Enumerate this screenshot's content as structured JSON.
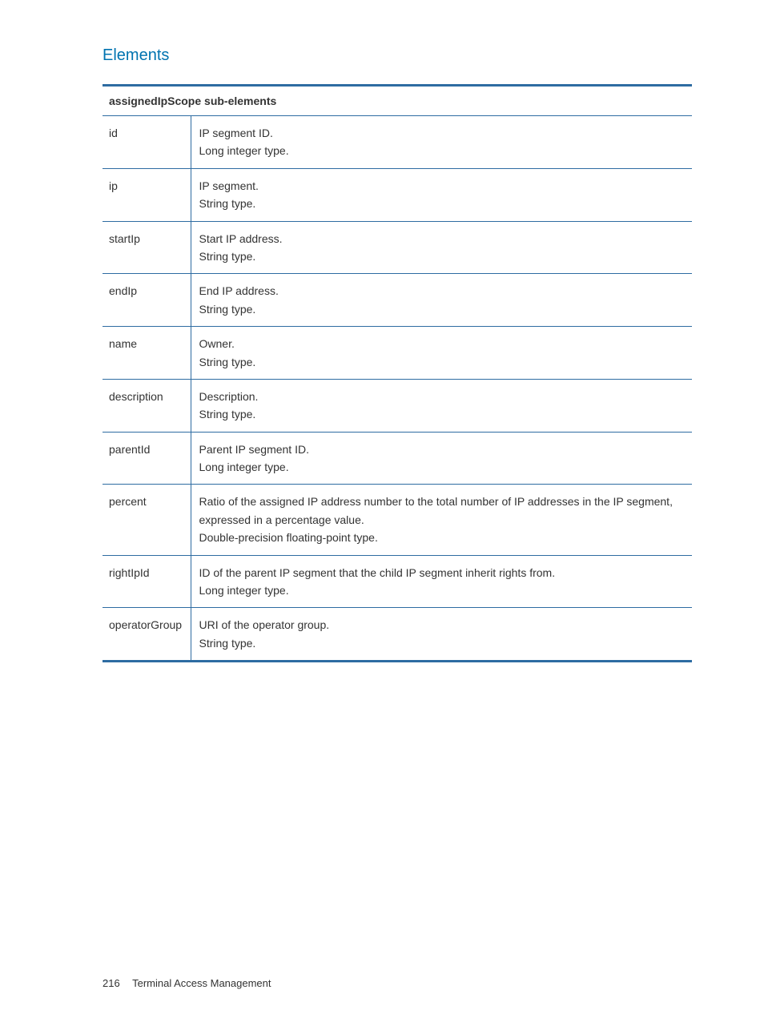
{
  "heading": "Elements",
  "table": {
    "header": "assignedIpScope sub-elements",
    "rows": [
      {
        "name": "id",
        "lines": [
          "IP segment ID.",
          "Long integer type."
        ]
      },
      {
        "name": "ip",
        "lines": [
          "IP segment.",
          "String type."
        ]
      },
      {
        "name": "startIp",
        "lines": [
          "Start IP address.",
          "String type."
        ]
      },
      {
        "name": "endIp",
        "lines": [
          "End IP address.",
          "String type."
        ]
      },
      {
        "name": "name",
        "lines": [
          "Owner.",
          "String type."
        ]
      },
      {
        "name": "description",
        "lines": [
          "Description.",
          "String type."
        ]
      },
      {
        "name": "parentId",
        "lines": [
          "Parent IP segment ID.",
          "Long integer type."
        ]
      },
      {
        "name": "percent",
        "lines": [
          "Ratio of the assigned IP address number to the total number of IP addresses in the IP segment, expressed in a percentage value.",
          "Double-precision floating-point type."
        ]
      },
      {
        "name": "rightIpId",
        "lines": [
          "ID of the parent IP segment that the child IP segment inherit rights from.",
          "Long integer type."
        ]
      },
      {
        "name": "operatorGroup",
        "lines": [
          "URI of the operator group.",
          "String type."
        ]
      }
    ]
  },
  "footer": {
    "pageNumber": "216",
    "chapterTitle": "Terminal Access Management"
  }
}
